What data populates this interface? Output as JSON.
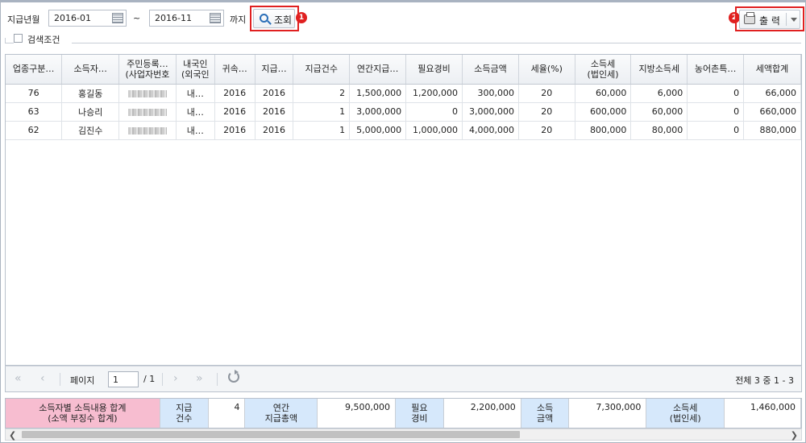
{
  "toolbar": {
    "pay_month_label": "지급년월",
    "start_date": "2016-01",
    "tilde": "~",
    "end_date": "2016-11",
    "until_label": "까지",
    "search_label": "조회",
    "print_label": "출 력",
    "badge_1": "1",
    "badge_2": "2",
    "accent_red": "#e02020"
  },
  "conditions": {
    "label": "검색조건"
  },
  "grid": {
    "columns": [
      "업종구분…",
      "소득자…",
      "주민등록…\n(사업자번호",
      "내국인\n(외국인",
      "귀속…",
      "지급…",
      "지급건수",
      "연간지급…",
      "필요경비",
      "소득금액",
      "세율(%)",
      "소득세\n(법인세)",
      "지방소득세",
      "농어촌특…",
      "세액합계"
    ],
    "rows": [
      [
        "76",
        "홍길동",
        "",
        "내…",
        "2016",
        "2016",
        "2",
        "1,500,000",
        "1,200,000",
        "300,000",
        "20",
        "60,000",
        "6,000",
        "0",
        "66,000"
      ],
      [
        "63",
        "나승리",
        "",
        "내…",
        "2016",
        "2016",
        "1",
        "3,000,000",
        "0",
        "3,000,000",
        "20",
        "600,000",
        "60,000",
        "0",
        "660,000"
      ],
      [
        "62",
        "김진수",
        "",
        "내…",
        "2016",
        "2016",
        "1",
        "5,000,000",
        "1,000,000",
        "4,000,000",
        "20",
        "800,000",
        "80,000",
        "0",
        "880,000"
      ]
    ]
  },
  "pager": {
    "first": "«",
    "prev": "‹",
    "page_label": "페이지",
    "page_value": "1",
    "total_pages": "/ 1",
    "next": "›",
    "last": "»",
    "info": "전체 3 중 1 - 3"
  },
  "summary": {
    "title": "소득자별 소득내용 합계\n(소액 부징수 합계)",
    "count_label": "지급\n건수",
    "count_value": "4",
    "annual_label": "연간\n지급총액",
    "annual_value": "9,500,000",
    "expense_label": "필요\n경비",
    "expense_value": "2,200,000",
    "income_label": "소득\n금액",
    "income_value": "7,300,000",
    "tax_label": "소득세\n(법인세)",
    "tax_value": "1,460,000"
  }
}
